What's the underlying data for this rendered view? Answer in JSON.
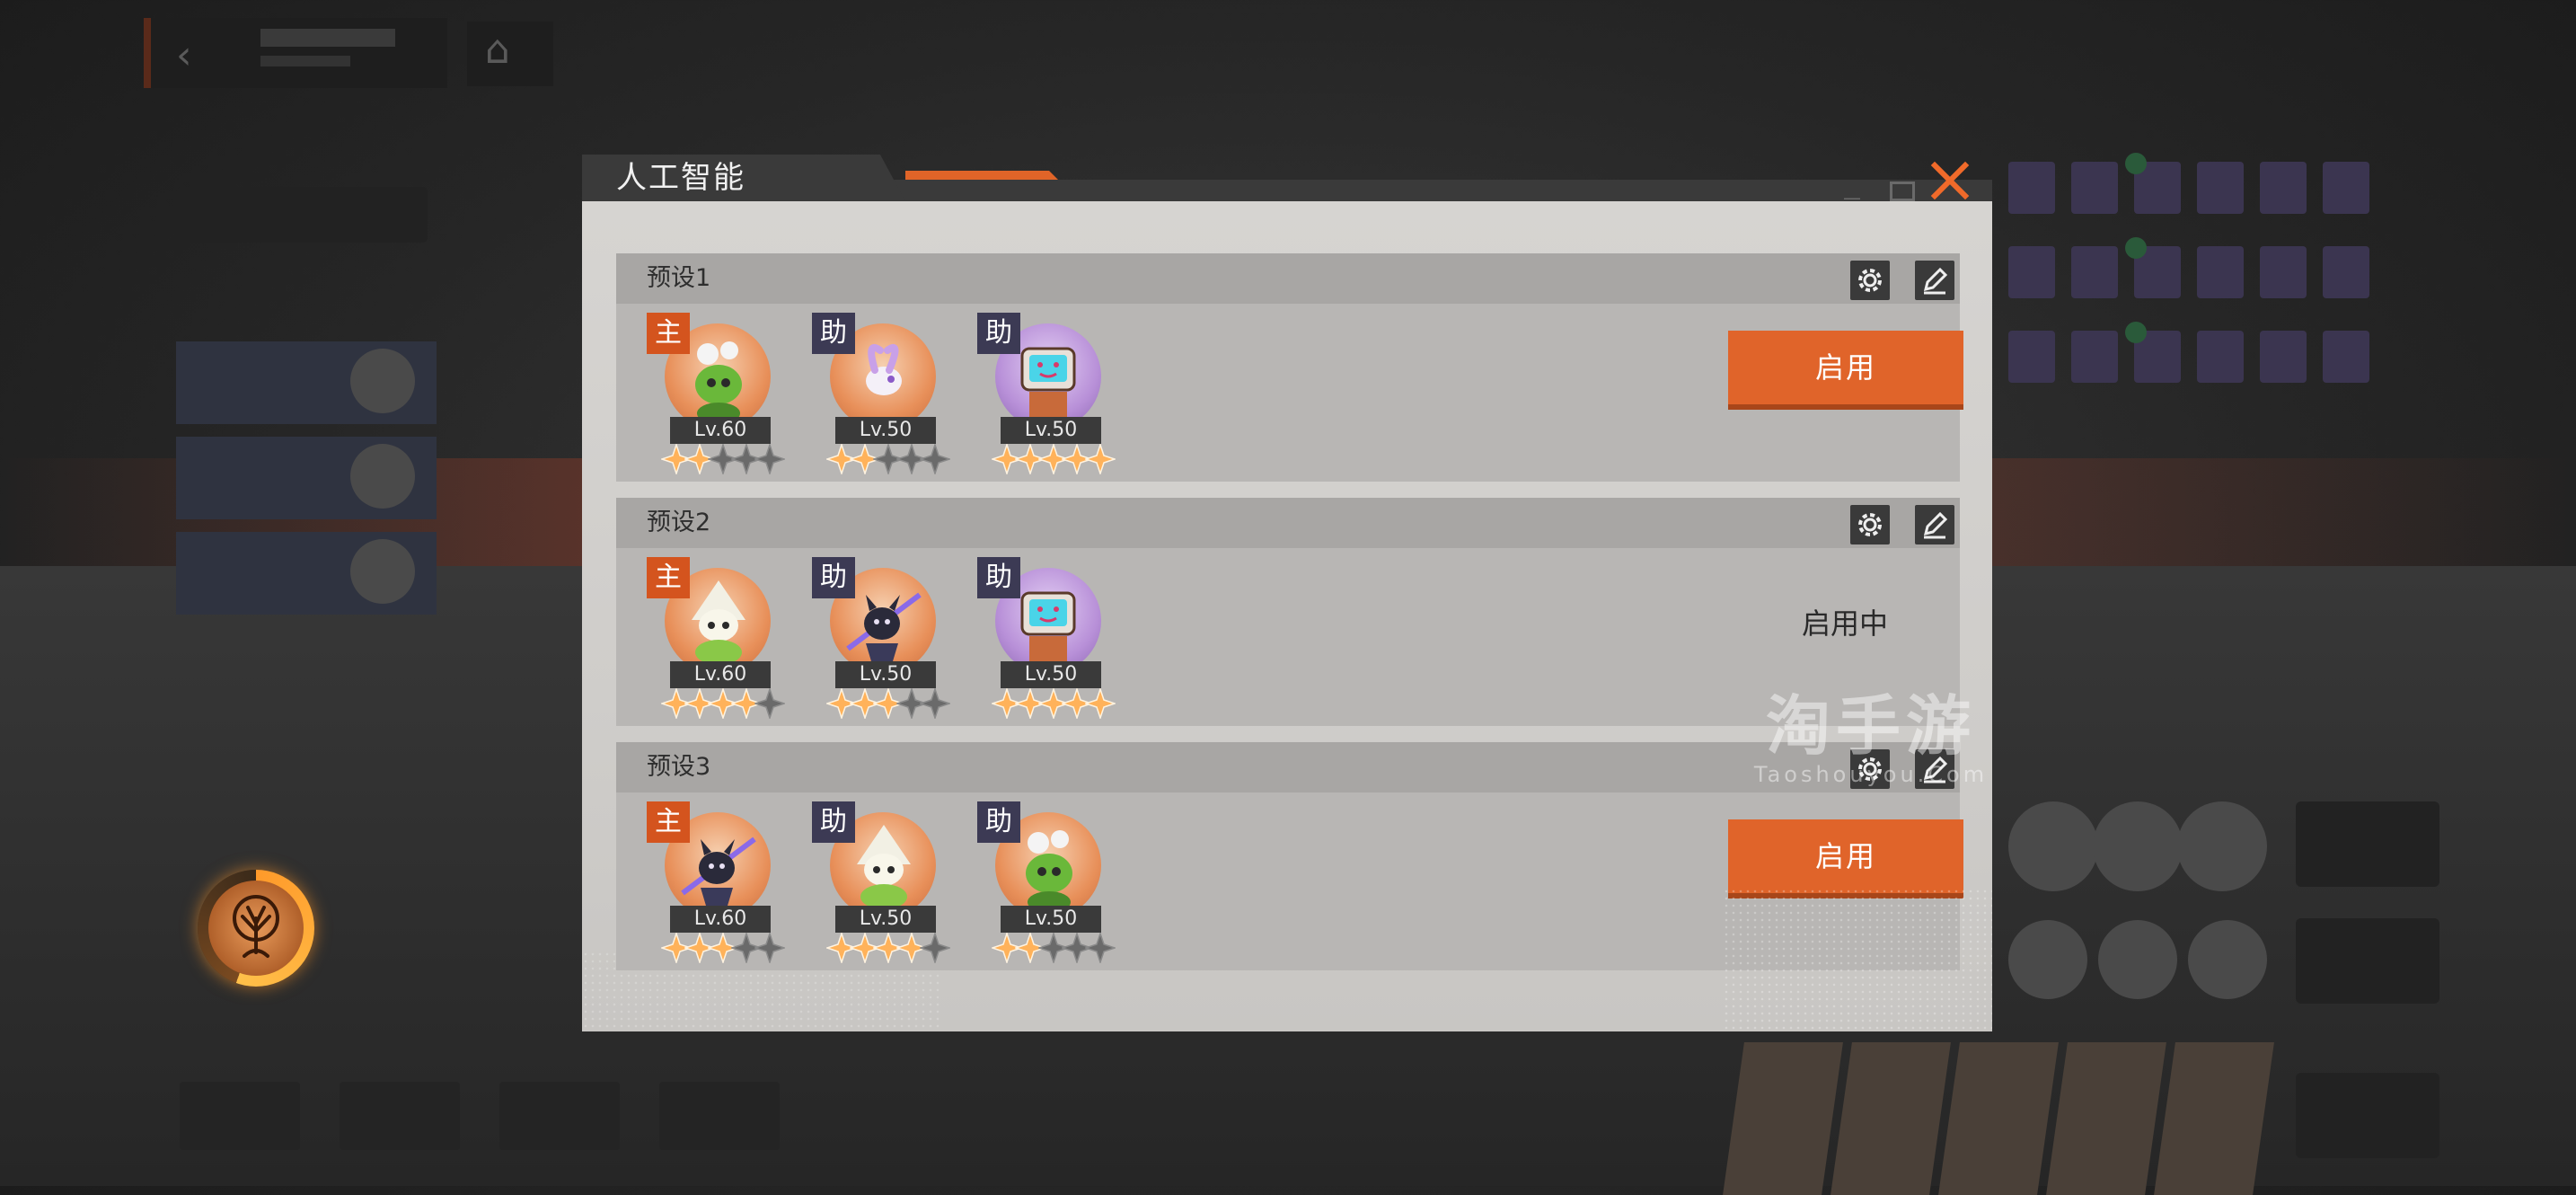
{
  "modal": {
    "title": "人工智能",
    "colors": {
      "accent": "#e0642a",
      "close": "#f06a2a",
      "main_tag": "#d4541e",
      "assist_tag": "#3c3a54",
      "star_on": "#ffb25a",
      "star_off": "#6a6a6a"
    }
  },
  "presets": [
    {
      "name": "预设1",
      "action": "启用",
      "active": false,
      "members": [
        {
          "role": "主",
          "level": "Lv.60",
          "stars": 2,
          "character": "green-plant-hero"
        },
        {
          "role": "助",
          "level": "Lv.50",
          "stars": 2,
          "character": "pink-bunny-spirit"
        },
        {
          "role": "助",
          "level": "Lv.50",
          "stars": 5,
          "character": "tv-robot"
        }
      ]
    },
    {
      "name": "预设2",
      "action": "启用中",
      "active": true,
      "members": [
        {
          "role": "主",
          "level": "Lv.60",
          "stars": 4,
          "character": "white-hat-sprout"
        },
        {
          "role": "助",
          "level": "Lv.50",
          "stars": 3,
          "character": "dark-ninja-cat"
        },
        {
          "role": "助",
          "level": "Lv.50",
          "stars": 5,
          "character": "tv-robot"
        }
      ]
    },
    {
      "name": "预设3",
      "action": "启用",
      "active": false,
      "members": [
        {
          "role": "主",
          "level": "Lv.60",
          "stars": 3,
          "character": "dark-ninja-cat"
        },
        {
          "role": "助",
          "level": "Lv.50",
          "stars": 4,
          "character": "white-hat-sprout"
        },
        {
          "role": "助",
          "level": "Lv.50",
          "stars": 2,
          "character": "green-plant-hero"
        }
      ]
    }
  ],
  "watermark": {
    "main": "淘手游",
    "sub": "Taoshouyou.Com"
  }
}
